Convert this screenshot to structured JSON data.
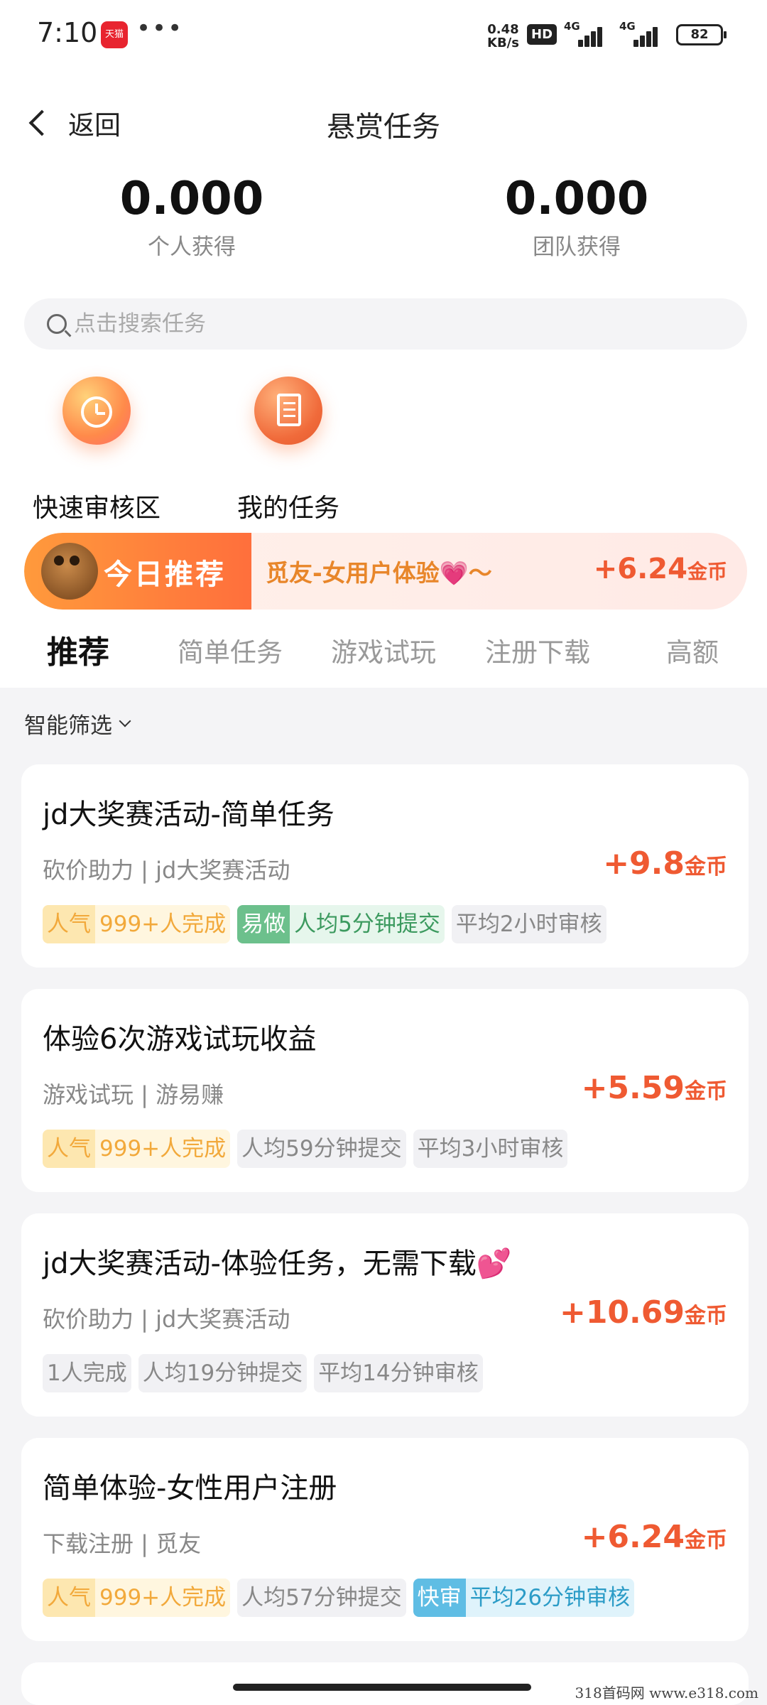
{
  "status_bar": {
    "time": "7:10",
    "app_badge": "天猫",
    "more": "•••",
    "speed_value": "0.48",
    "speed_unit": "KB/s",
    "hd": "HD",
    "net1": "4G",
    "net2": "4G",
    "battery": "82"
  },
  "header": {
    "back_label": "返回",
    "title": "悬赏任务"
  },
  "stats": [
    {
      "value": "0.000",
      "label": "个人获得"
    },
    {
      "value": "0.000",
      "label": "团队获得"
    }
  ],
  "search": {
    "placeholder": "点击搜索任务"
  },
  "entries": [
    {
      "label": "快速审核区",
      "icon": "alarm-clock-icon"
    },
    {
      "label": "我的任务",
      "icon": "notebook-icon"
    }
  ],
  "banner": {
    "tag": "今日推荐",
    "text": "觅友-女用户体验💗～",
    "reward_value": "+6.24",
    "reward_unit": "金币"
  },
  "tabs": [
    "推荐",
    "简单任务",
    "游戏试玩",
    "注册下载",
    "高额"
  ],
  "active_tab": 0,
  "filter_label": "智能筛选",
  "tasks": [
    {
      "title": "jd大奖赛活动-简单任务",
      "subtitle": "砍价助力 | jd大奖赛活动",
      "reward_value": "+9.8",
      "reward_unit": "金币",
      "tags": [
        {
          "style": "pop",
          "key": "人气",
          "value": "999+人完成"
        },
        {
          "style": "easy",
          "key": "易做",
          "value": "人均5分钟提交"
        },
        {
          "style": "gray",
          "key": "",
          "value": "平均2小时审核"
        }
      ]
    },
    {
      "title": "体验6次游戏试玩收益",
      "subtitle": "游戏试玩 | 游易赚",
      "reward_value": "+5.59",
      "reward_unit": "金币",
      "tags": [
        {
          "style": "pop",
          "key": "人气",
          "value": "999+人完成"
        },
        {
          "style": "gray",
          "key": "",
          "value": "人均59分钟提交"
        },
        {
          "style": "gray",
          "key": "",
          "value": "平均3小时审核"
        }
      ]
    },
    {
      "title": "jd大奖赛活动-体验任务，无需下载💕",
      "subtitle": "砍价助力 | jd大奖赛活动",
      "reward_value": "+10.69",
      "reward_unit": "金币",
      "tags": [
        {
          "style": "gray",
          "key": "",
          "value": "1人完成"
        },
        {
          "style": "gray",
          "key": "",
          "value": "人均19分钟提交"
        },
        {
          "style": "gray",
          "key": "",
          "value": "平均14分钟审核"
        }
      ]
    },
    {
      "title": "简单体验-女性用户注册",
      "subtitle": "下载注册 | 觅友",
      "reward_value": "+6.24",
      "reward_unit": "金币",
      "tags": [
        {
          "style": "pop",
          "key": "人气",
          "value": "999+人完成"
        },
        {
          "style": "gray",
          "key": "",
          "value": "人均57分钟提交"
        },
        {
          "style": "fast",
          "key": "快审",
          "value": "平均26分钟审核"
        }
      ]
    }
  ],
  "watermark": "318首码网  www.e318.com"
}
